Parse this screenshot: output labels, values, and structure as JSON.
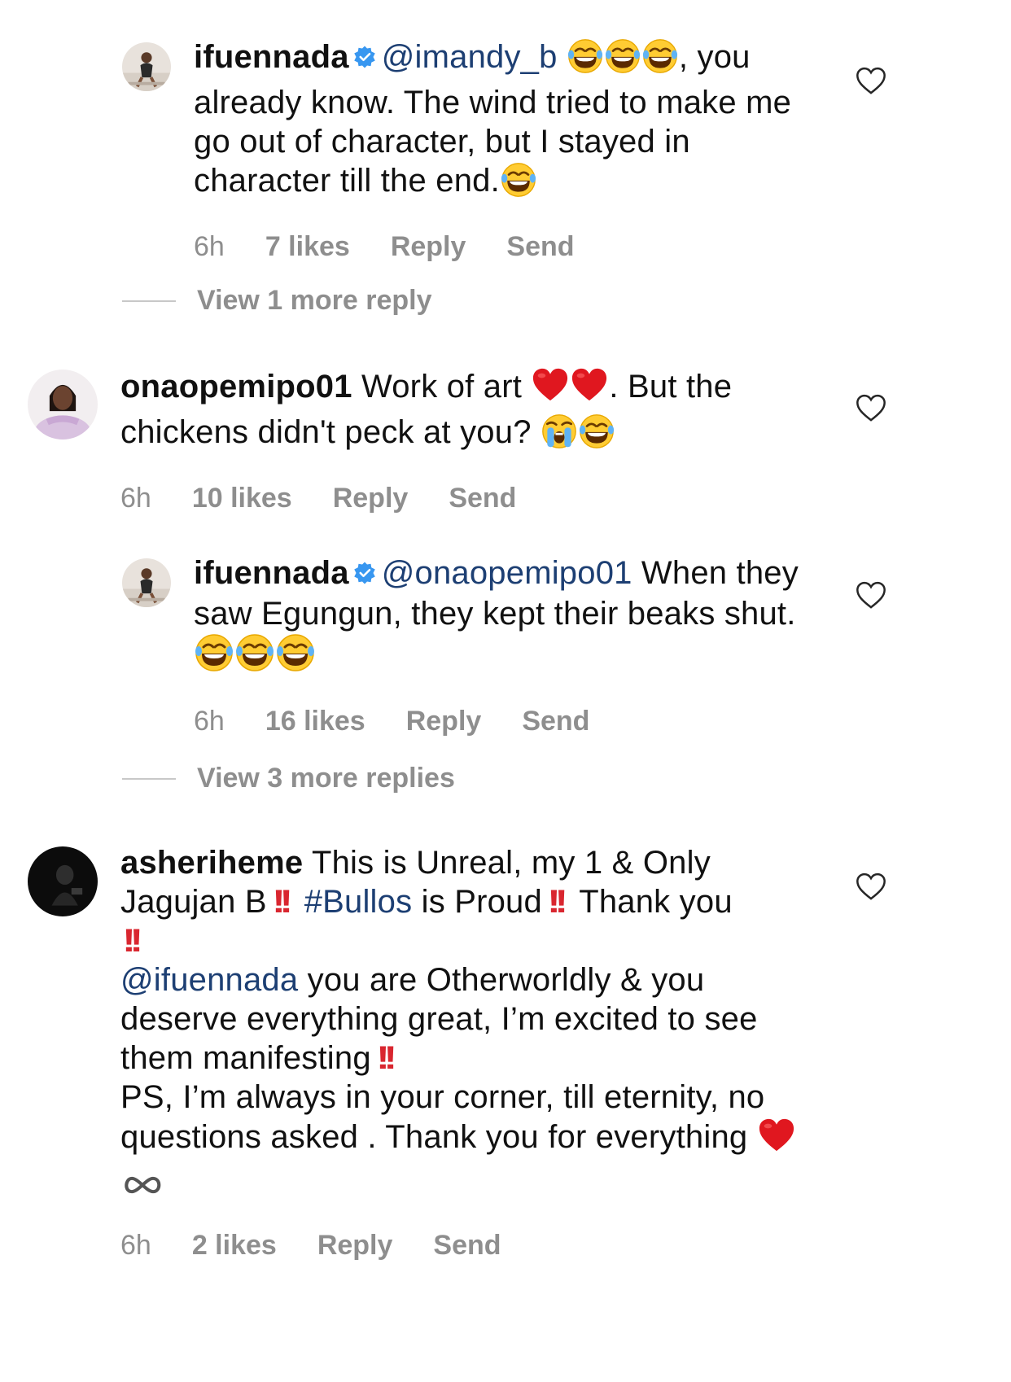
{
  "comments": [
    {
      "username": "ifuennada",
      "mention": "@imandy_b",
      "text_after_emojis": ", you already know. The wind tried to make me go out of character, but I stayed in character till the end.",
      "time": "6h",
      "likes": "7 likes",
      "reply": "Reply",
      "send": "Send"
    },
    {
      "username": "onaopemipo01",
      "text_a": "Work of art",
      "text_b": ". But the chickens didn't peck at you?",
      "time": "6h",
      "likes": "10 likes",
      "reply": "Reply",
      "send": "Send"
    },
    {
      "username": "ifuennada",
      "mention": "@onaopemipo01",
      "text": "When they saw Egungun, they kept their beaks shut.",
      "time": "6h",
      "likes": "16 likes",
      "reply": "Reply",
      "send": "Send"
    },
    {
      "username": "asheriheme",
      "text_a": "This is Unreal, my 1 & Only Jagujan B",
      "hashtag": "#Bullos",
      "text_b": "is Proud",
      "text_c": "Thank you",
      "mention": "@ifuennada",
      "text_d": "you are Otherworldly & you deserve everything great,  I’m excited to see them manifesting",
      "text_e": "PS, I’m always in your corner, till eternity, no questions asked . Thank you for everything",
      "time": "6h",
      "likes": "2 likes",
      "reply": "Reply",
      "send": "Send"
    }
  ],
  "view_more": [
    {
      "label": "View 1 more reply"
    },
    {
      "label": "View 3 more replies"
    }
  ],
  "colors": {
    "mention": "#1d3f73",
    "meta": "#8e8e8e",
    "verified": "#3897f0",
    "bang": "#d9262f",
    "heart_emoji": "#e0171f"
  },
  "icons": [
    "verified-badge-icon",
    "heart-outline-icon",
    "laughing-emoji",
    "crying-emoji",
    "red-heart-emoji",
    "double-exclamation-emoji",
    "infinity-icon"
  ]
}
